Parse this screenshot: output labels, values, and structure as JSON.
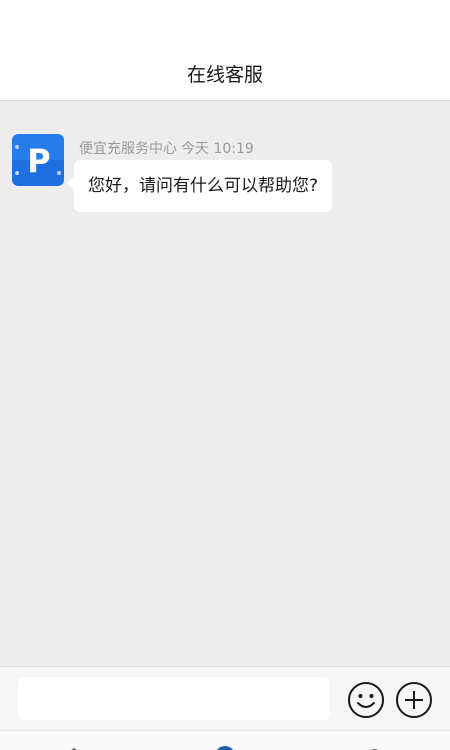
{
  "header": {
    "title": "在线客服"
  },
  "chat": {
    "messages": [
      {
        "sender": "便宜充服务中心",
        "time": "今天 10:19",
        "text": "您好，请问有什么可以帮助您?",
        "avatar_letter": "P",
        "avatar_color": "#1e6fe0"
      }
    ]
  },
  "input_bar": {
    "value": "",
    "placeholder": "",
    "icons": [
      "smiley-icon",
      "plus-circle-icon"
    ]
  },
  "bottom_nav": {
    "icons": [
      "home-icon",
      "chat-icon",
      "user-icon"
    ],
    "active_color": "#1e5fa8"
  },
  "colors": {
    "background": "#ededed",
    "header": "#ffffff",
    "bubble": "#ffffff"
  }
}
